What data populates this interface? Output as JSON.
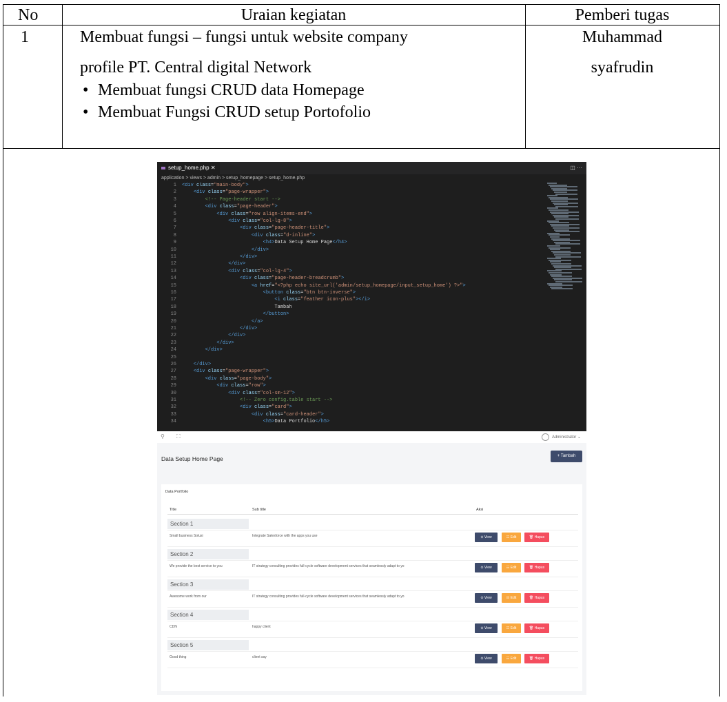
{
  "table": {
    "headers": [
      "No",
      "Uraian kegiatan",
      "Pemberi tugas"
    ],
    "row": {
      "no": "1",
      "desc_line1": "Membuat fungsi – fungsi untuk website company",
      "desc_line2": "profile PT. Central digital Network",
      "bullets": [
        "Membuat fungsi CRUD data Homepage",
        "Membuat Fungsi CRUD setup Portofolio"
      ],
      "assignee_line1": "Muhammad",
      "assignee_line2": "syafrudin"
    }
  },
  "ide": {
    "tab": "setup_home.php",
    "breadcrumb": "application > views > admin > setup_homepage > setup_home.php",
    "code_lines": [
      [
        [
          "t",
          "<div "
        ],
        [
          "a",
          "class"
        ],
        [
          "w",
          "="
        ],
        [
          "s",
          "\"main-body\""
        ],
        [
          "t",
          ">"
        ]
      ],
      [
        [
          "w",
          "    "
        ],
        [
          "t",
          "<div "
        ],
        [
          "a",
          "class"
        ],
        [
          "w",
          "="
        ],
        [
          "s",
          "\"page-wrapper\""
        ],
        [
          "t",
          ">"
        ]
      ],
      [
        [
          "w",
          "        "
        ],
        [
          "c",
          "<!-- Page-header start -->"
        ]
      ],
      [
        [
          "w",
          "        "
        ],
        [
          "t",
          "<div "
        ],
        [
          "a",
          "class"
        ],
        [
          "w",
          "="
        ],
        [
          "s",
          "\"page-header\""
        ],
        [
          "t",
          ">"
        ]
      ],
      [
        [
          "w",
          "            "
        ],
        [
          "t",
          "<div "
        ],
        [
          "a",
          "class"
        ],
        [
          "w",
          "="
        ],
        [
          "s",
          "\"row align-items-end\""
        ],
        [
          "t",
          ">"
        ]
      ],
      [
        [
          "w",
          "                "
        ],
        [
          "t",
          "<div "
        ],
        [
          "a",
          "class"
        ],
        [
          "w",
          "="
        ],
        [
          "s",
          "\"col-lg-8\""
        ],
        [
          "t",
          ">"
        ]
      ],
      [
        [
          "w",
          "                    "
        ],
        [
          "t",
          "<div "
        ],
        [
          "a",
          "class"
        ],
        [
          "w",
          "="
        ],
        [
          "s",
          "\"page-header-title\""
        ],
        [
          "t",
          ">"
        ]
      ],
      [
        [
          "w",
          "                        "
        ],
        [
          "t",
          "<div "
        ],
        [
          "a",
          "class"
        ],
        [
          "w",
          "="
        ],
        [
          "s",
          "\"d-inline\""
        ],
        [
          "t",
          ">"
        ]
      ],
      [
        [
          "w",
          "                            "
        ],
        [
          "t",
          "<h4>"
        ],
        [
          "w",
          "Data Setup Home Page"
        ],
        [
          "t",
          "</h4>"
        ]
      ],
      [
        [
          "w",
          "                        "
        ],
        [
          "t",
          "</div>"
        ]
      ],
      [
        [
          "w",
          "                    "
        ],
        [
          "t",
          "</div>"
        ]
      ],
      [
        [
          "w",
          "                "
        ],
        [
          "t",
          "</div>"
        ]
      ],
      [
        [
          "w",
          "                "
        ],
        [
          "t",
          "<div "
        ],
        [
          "a",
          "class"
        ],
        [
          "w",
          "="
        ],
        [
          "s",
          "\"col-lg-4\""
        ],
        [
          "t",
          ">"
        ]
      ],
      [
        [
          "w",
          "                    "
        ],
        [
          "t",
          "<div "
        ],
        [
          "a",
          "class"
        ],
        [
          "w",
          "="
        ],
        [
          "s",
          "\"page-header-breadcrumb\""
        ],
        [
          "t",
          ">"
        ]
      ],
      [
        [
          "w",
          "                        "
        ],
        [
          "t",
          "<a "
        ],
        [
          "a",
          "href"
        ],
        [
          "w",
          "="
        ],
        [
          "s",
          "\"<?php echo site_url('admin/setup_homepage/input_setup_home') ?>\""
        ],
        [
          "t",
          ">"
        ]
      ],
      [
        [
          "w",
          "                            "
        ],
        [
          "t",
          "<button "
        ],
        [
          "a",
          "class"
        ],
        [
          "w",
          "="
        ],
        [
          "s",
          "\"btn btn-inverse\""
        ],
        [
          "t",
          ">"
        ]
      ],
      [
        [
          "w",
          "                                "
        ],
        [
          "t",
          "<i "
        ],
        [
          "a",
          "class"
        ],
        [
          "w",
          "="
        ],
        [
          "s",
          "\"feather icon-plus\""
        ],
        [
          "t",
          "></i>"
        ]
      ],
      [
        [
          "w",
          "                                Tambah"
        ]
      ],
      [
        [
          "w",
          "                            "
        ],
        [
          "t",
          "</button>"
        ]
      ],
      [
        [
          "w",
          "                        "
        ],
        [
          "t",
          "</a>"
        ]
      ],
      [
        [
          "w",
          "                    "
        ],
        [
          "t",
          "</div>"
        ]
      ],
      [
        [
          "w",
          "                "
        ],
        [
          "t",
          "</div>"
        ]
      ],
      [
        [
          "w",
          "            "
        ],
        [
          "t",
          "</div>"
        ]
      ],
      [
        [
          "w",
          "        "
        ],
        [
          "t",
          "</div>"
        ]
      ],
      [
        [
          "w",
          ""
        ]
      ],
      [
        [
          "w",
          "    "
        ],
        [
          "t",
          "</div>"
        ]
      ],
      [
        [
          "w",
          "    "
        ],
        [
          "t",
          "<div "
        ],
        [
          "a",
          "class"
        ],
        [
          "w",
          "="
        ],
        [
          "s",
          "\"page-wrapper\""
        ],
        [
          "t",
          ">"
        ]
      ],
      [
        [
          "w",
          "        "
        ],
        [
          "t",
          "<div "
        ],
        [
          "a",
          "class"
        ],
        [
          "w",
          "="
        ],
        [
          "s",
          "\"page-body\""
        ],
        [
          "t",
          ">"
        ]
      ],
      [
        [
          "w",
          "            "
        ],
        [
          "t",
          "<div "
        ],
        [
          "a",
          "class"
        ],
        [
          "w",
          "="
        ],
        [
          "s",
          "\"row\""
        ],
        [
          "t",
          ">"
        ]
      ],
      [
        [
          "w",
          "                "
        ],
        [
          "t",
          "<div "
        ],
        [
          "a",
          "class"
        ],
        [
          "w",
          "="
        ],
        [
          "s",
          "\"col-sm-12\""
        ],
        [
          "t",
          ">"
        ]
      ],
      [
        [
          "w",
          "                    "
        ],
        [
          "c",
          "<!-- Zero config.table start -->"
        ]
      ],
      [
        [
          "w",
          "                    "
        ],
        [
          "t",
          "<div "
        ],
        [
          "a",
          "class"
        ],
        [
          "w",
          "="
        ],
        [
          "s",
          "\"card\""
        ],
        [
          "t",
          ">"
        ]
      ],
      [
        [
          "w",
          "                        "
        ],
        [
          "t",
          "<div "
        ],
        [
          "a",
          "class"
        ],
        [
          "w",
          "="
        ],
        [
          "s",
          "\"card-header\""
        ],
        [
          "t",
          ">"
        ]
      ],
      [
        [
          "w",
          "                            "
        ],
        [
          "t",
          "<h5>"
        ],
        [
          "w",
          "Data Portfolio"
        ],
        [
          "t",
          "</h5>"
        ]
      ]
    ]
  },
  "app": {
    "user": "Administrator",
    "page_title": "Data Setup Home Page",
    "add_button": "+ Tambah",
    "card_title": "Data Portfolio",
    "columns": [
      "Title",
      "Sub title",
      "Aksi"
    ],
    "buttons": {
      "view": "⊙ View",
      "edit": "☷ Edit",
      "hapus": "🗑 Hapus"
    },
    "rows": [
      {
        "section": "Section 1",
        "title": "Small business Solusi",
        "subtitle": "Integrate Salesforce with the apps you use"
      },
      {
        "section": "Section 2",
        "title": "We provide the best service to you",
        "subtitle": "IT strategy consulting provides full-cycle software development services that seamlessly adapt to yo"
      },
      {
        "section": "Section 3",
        "title": "Awesome work from our",
        "subtitle": "IT strategy consulting provides full-cycle software development services that seamlessly adapt to yo"
      },
      {
        "section": "Section 4",
        "title": "CDN",
        "subtitle": "happy client"
      },
      {
        "section": "Section 5",
        "title": "Good thing",
        "subtitle": "client say"
      }
    ]
  }
}
